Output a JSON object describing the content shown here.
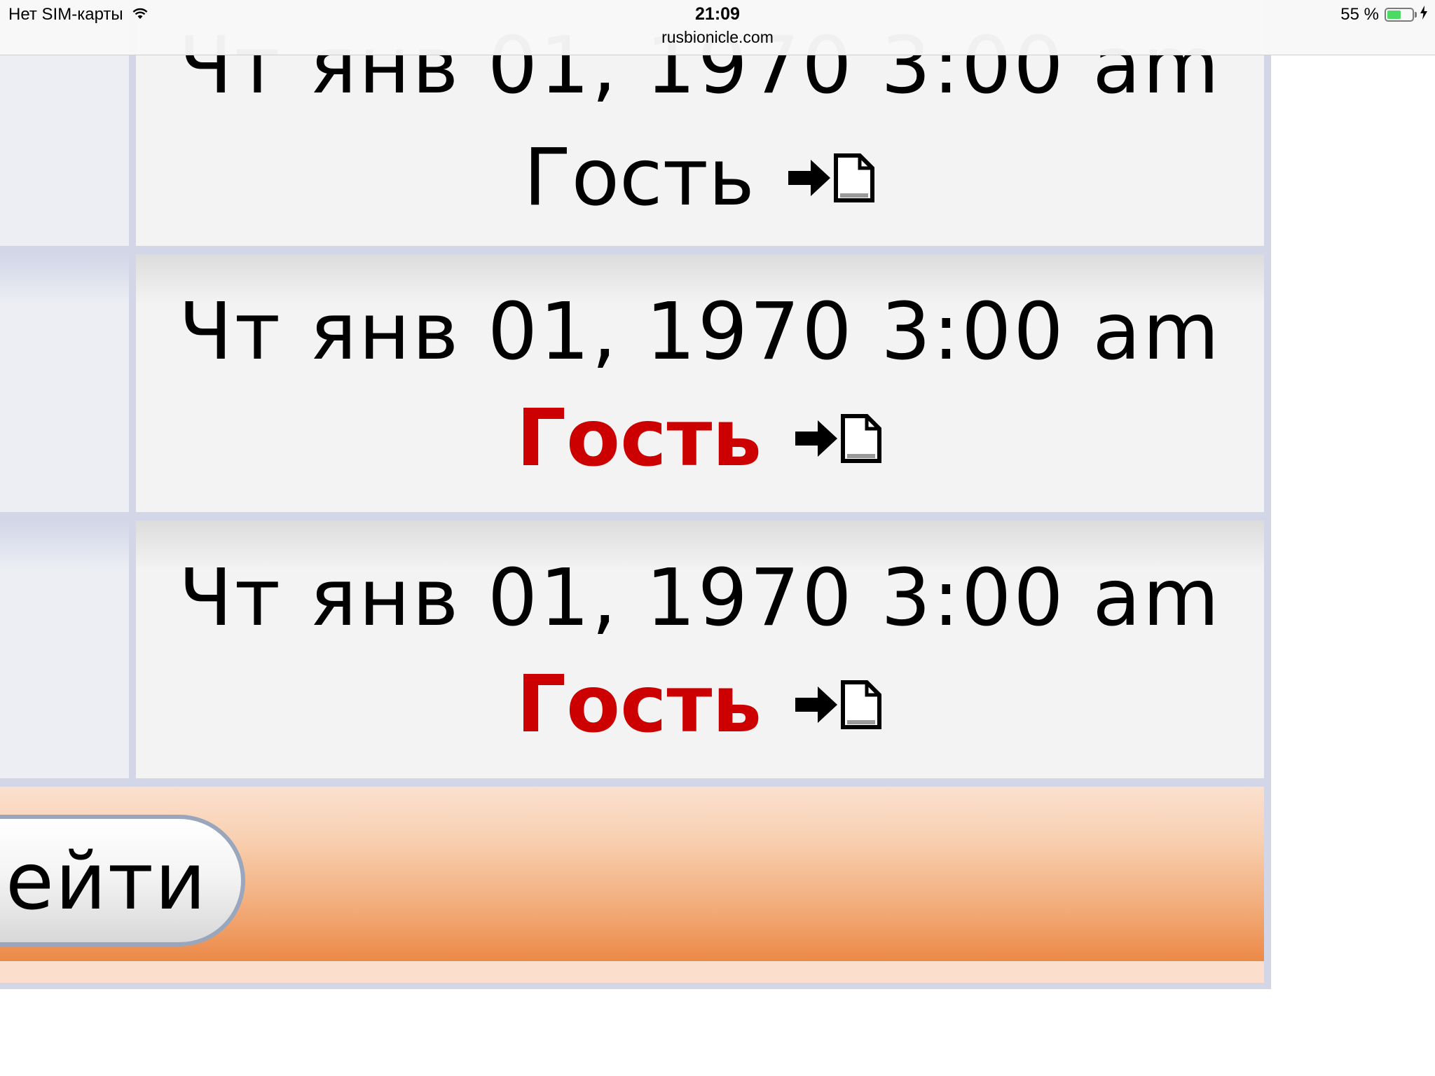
{
  "status_bar": {
    "carrier": "Нет SIM-карты",
    "time": "21:09",
    "battery_percent": "55 %",
    "battery_level": 0.55,
    "url": "rusbionicle.com"
  },
  "rows": [
    {
      "date": "Чт янв 01, 1970 3:00 am",
      "author": "Гость",
      "author_color": "#000000"
    },
    {
      "date": "Чт янв 01, 1970 3:00 am",
      "author": "Гость",
      "author_color": "#cc0000"
    },
    {
      "date": "Чт янв 01, 1970 3:00 am",
      "author": "Гость",
      "author_color": "#cc0000"
    }
  ],
  "footer": {
    "go_button_label": "ейти"
  },
  "icons": {
    "goto_post": "arrow-to-page-icon",
    "wifi": "wifi-icon",
    "battery": "battery-icon",
    "charging": "bolt-icon"
  },
  "colors": {
    "guest_highlight": "#cc0000",
    "footer_gradient_bottom": "#ec8947",
    "table_border": "#d2d6e7"
  }
}
